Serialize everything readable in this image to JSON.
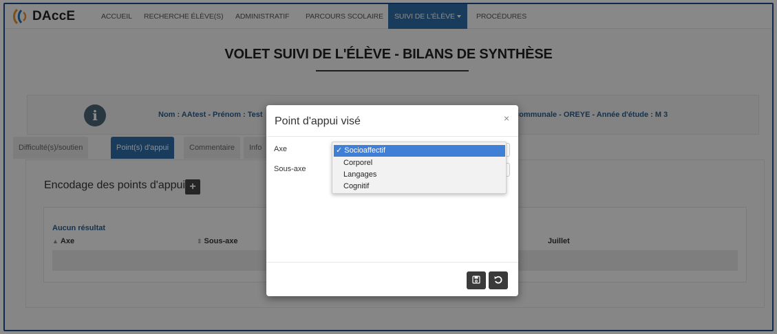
{
  "app": {
    "brand": "DAccE",
    "nav": [
      {
        "label": "ACCUEIL"
      },
      {
        "label": "RECHERCHE ÉLÈVE(S)"
      },
      {
        "label": "ADMINISTRATIF"
      },
      {
        "label": "PARCOURS SCOLAIRE"
      },
      {
        "label": "SUIVI DE L'ÉLÈVE"
      },
      {
        "label": "PROCÉDURES"
      }
    ],
    "active_nav": "SUIVI DE L'ÉLÈVE"
  },
  "page": {
    "title": "VOLET SUIVI DE L'ÉLÈVE - BILANS DE SYNTHÈSE",
    "help_icon": "?"
  },
  "info": {
    "icon": "i",
    "left_text": "Nom : AAtest - Prénom : Test",
    "right_text": "communale - OREYE - Année d'étude : M 3"
  },
  "tabs": [
    {
      "label": "Difficulté(s)/soutien"
    },
    {
      "label": "Point(s) d'appui"
    },
    {
      "label": "Commentaire"
    },
    {
      "label": "Info"
    }
  ],
  "content": {
    "section_title": "Encodage des points d'appui",
    "add_icon": "+",
    "no_result": "Aucun résultat",
    "columns": [
      {
        "label": "Axe",
        "sort": "▲"
      },
      {
        "label": "Sous-axe",
        "sort": "⇕"
      },
      {
        "label": "Juillet"
      }
    ]
  },
  "modal": {
    "title": "Point d'appui visé",
    "close": "×",
    "fields": [
      {
        "label": "Axe"
      },
      {
        "label": "Sous-axe"
      }
    ],
    "dropdown": {
      "options": [
        "Socioaffectif",
        "Corporel",
        "Langages",
        "Cognitif"
      ],
      "selected": "Socioaffectif",
      "check": "✓"
    },
    "buttons": {
      "save_icon": "save-icon",
      "reset_icon": "undo-icon"
    }
  },
  "colors": {
    "accent": "#2f6ea8",
    "link_text": "#2a5c8c",
    "dropdown_highlight": "#3f7fd6"
  }
}
